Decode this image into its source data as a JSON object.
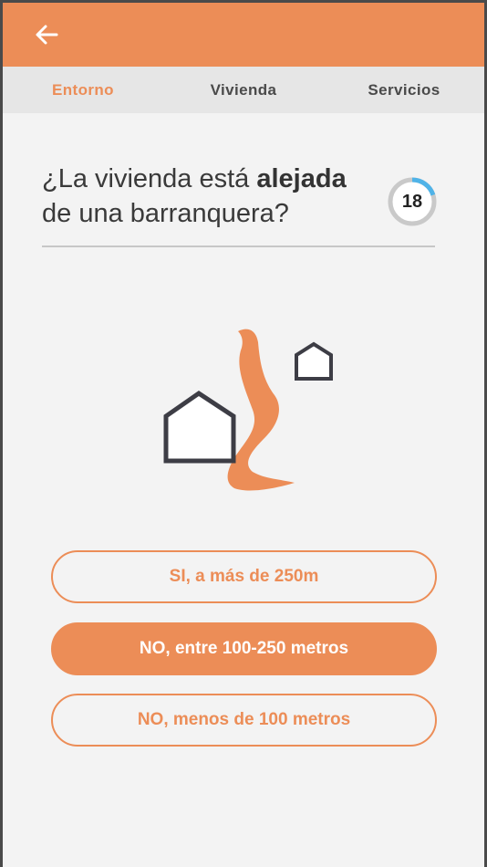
{
  "header": {
    "back_icon": "arrow-left-icon",
    "bg_color": "#ec8d57"
  },
  "tabs": [
    {
      "label": "Entorno",
      "active": true
    },
    {
      "label": "Vivienda",
      "active": false
    },
    {
      "label": "Servicios",
      "active": false
    }
  ],
  "question": {
    "prefix": "¿La vivienda está ",
    "emphasis": "alejada",
    "suffix": "de una barranquera?"
  },
  "progress": {
    "value": "18",
    "ring_fill_fraction": 0.2
  },
  "illustration": {
    "icon": "houses-ravine-illustration",
    "accent_color": "#ec8d57",
    "house_stroke_color": "#3d3d45"
  },
  "options": [
    {
      "label": "SI, a más de 250m",
      "selected": false
    },
    {
      "label": "NO, entre 100-250 metros",
      "selected": true
    },
    {
      "label": "NO, menos de 100 metros",
      "selected": false
    }
  ],
  "colors": {
    "accent": "#ec8d57",
    "background": "#f3f3f3",
    "tab_bar": "#e6e6e6",
    "progress_ring": "#4fb3e8"
  }
}
